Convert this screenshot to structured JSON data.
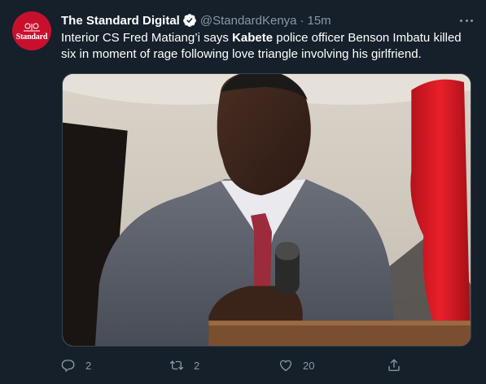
{
  "tweet": {
    "display_name": "The Standard Digital",
    "handle": "@StandardKenya",
    "separator": "·",
    "timestamp": "15m",
    "text_before": "Interior CS Fred Matiang’i says ",
    "text_bold": "Kabete",
    "text_after": " police officer Benson Imbatu killed six in moment of rage following love triangle involving his girlfriend.",
    "avatar_text": "Standard",
    "verified": true
  },
  "actions": {
    "reply_count": "2",
    "retweet_count": "2",
    "like_count": "20"
  },
  "icons": {
    "reply": "reply-icon",
    "retweet": "retweet-icon",
    "like": "heart-icon",
    "share": "share-icon",
    "more": "more-icon",
    "verified": "verified-badge-icon"
  },
  "colors": {
    "background": "#15202b",
    "secondary_text": "#8b98a5",
    "verified": "#ffffff",
    "avatar_bg": "#c8102e"
  }
}
